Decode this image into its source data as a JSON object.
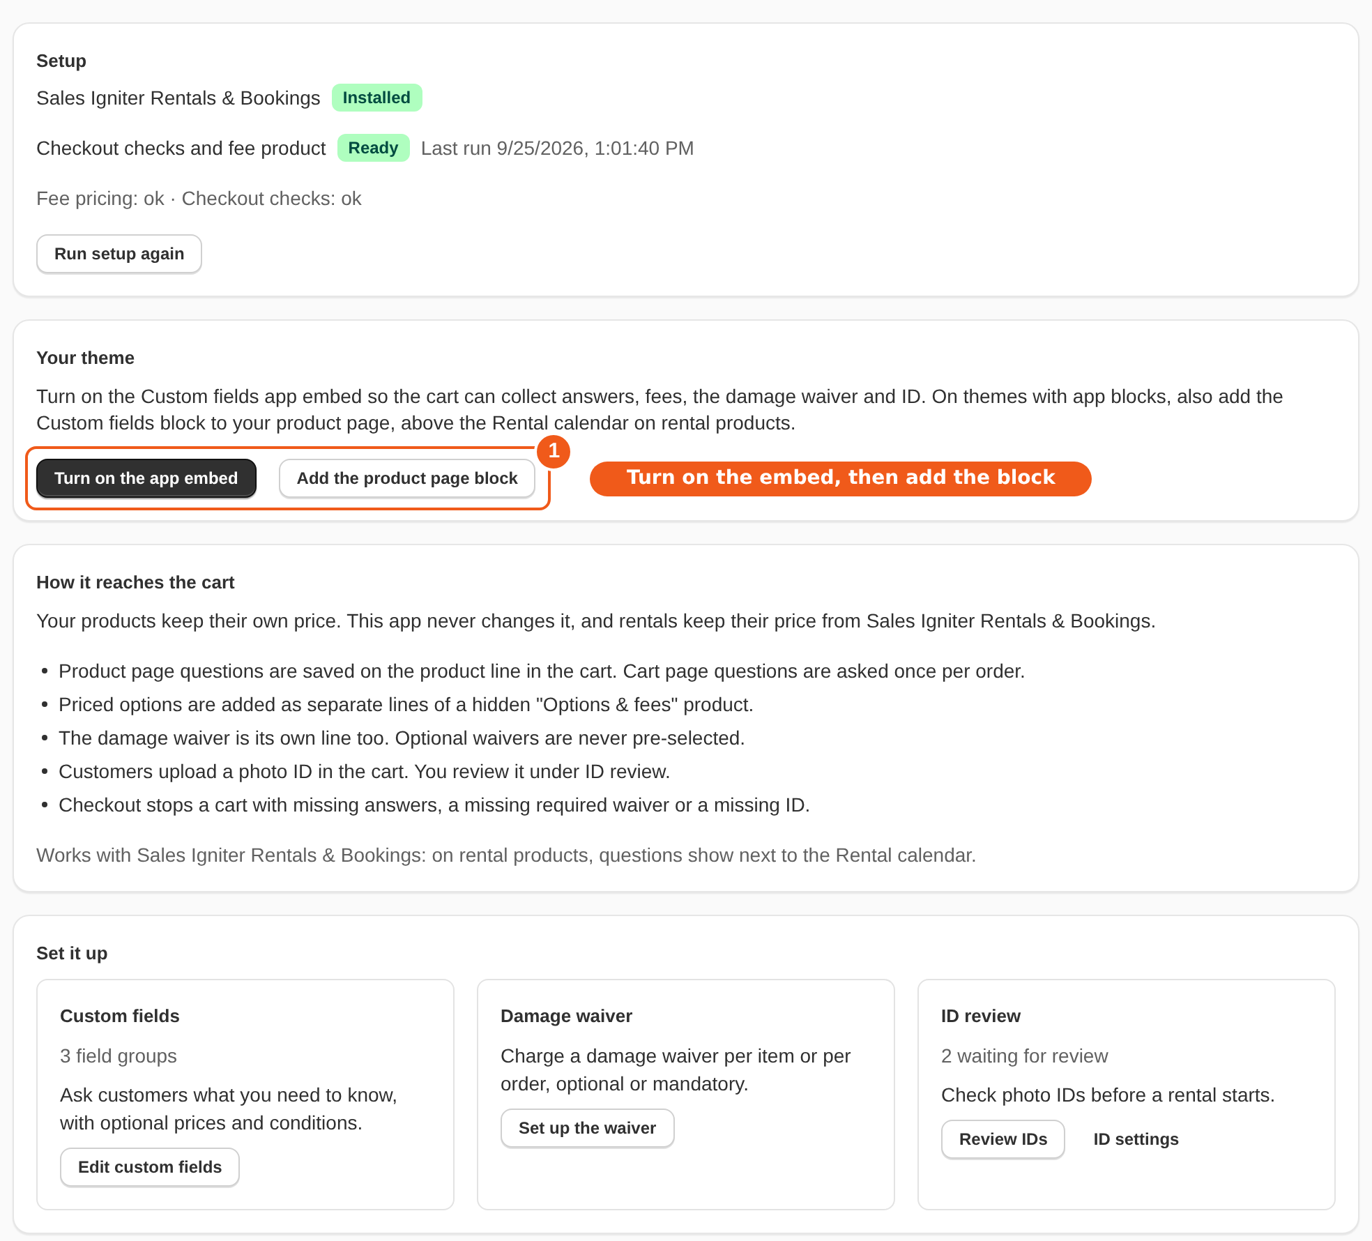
{
  "setup": {
    "title": "Setup",
    "status_rows": [
      {
        "label": "Sales Igniter Rentals & Bookings",
        "badge": "Installed"
      },
      {
        "label": "Checkout checks and fee product",
        "badge": "Ready",
        "note": "Last run 9/25/2026, 1:01:40 PM"
      }
    ],
    "summary": "Fee pricing: ok · Checkout checks: ok",
    "buttons": [
      {
        "label": "Run setup again",
        "kind": "secondary"
      }
    ]
  },
  "theme": {
    "title": "Your theme",
    "description": "Turn on the Custom fields app embed so the cart can collect answers, fees, the damage waiver and ID. On themes with app blocks, also add the Custom fields block to your product page, above the Rental calendar on rental products.",
    "buttons": [
      {
        "label": "Turn on the app embed",
        "kind": "primary"
      },
      {
        "label": "Add the product page block",
        "kind": "secondary"
      }
    ],
    "callout": {
      "number": "1",
      "label": "Turn on the embed, then add the block"
    }
  },
  "cart_flow": {
    "title": "How it reaches the cart",
    "intro": "Your products keep their own price. This app never changes it, and rentals keep their price from Sales Igniter Rentals & Bookings.",
    "bullets": [
      "Product page questions are saved on the product line in the cart. Cart page questions are asked once per order.",
      "Priced options are added as separate lines of a hidden \"Options & fees\" product.",
      "The damage waiver is its own line too. Optional waivers are never pre-selected.",
      "Customers upload a photo ID in the cart. You review it under ID review.",
      "Checkout stops a cart with missing answers, a missing required waiver or a missing ID."
    ],
    "footnote": "Works with Sales Igniter Rentals & Bookings: on rental products, questions show next to the Rental calendar."
  },
  "set_it_up": {
    "title": "Set it up",
    "cards": [
      {
        "title": "Custom fields",
        "meta": "3 field groups",
        "description": "Ask customers what you need to know, with optional prices and conditions.",
        "buttons": [
          {
            "label": "Edit custom fields",
            "kind": "secondary"
          }
        ]
      },
      {
        "title": "Damage waiver",
        "description": "Charge a damage waiver per item or per order, optional or mandatory.",
        "buttons": [
          {
            "label": "Set up the waiver",
            "kind": "secondary"
          }
        ]
      },
      {
        "title": "ID review",
        "meta": "2 waiting for review",
        "description": "Check photo IDs before a rental starts.",
        "buttons": [
          {
            "label": "Review IDs",
            "kind": "secondary"
          },
          {
            "label": "ID settings",
            "kind": "plain"
          }
        ]
      }
    ]
  }
}
